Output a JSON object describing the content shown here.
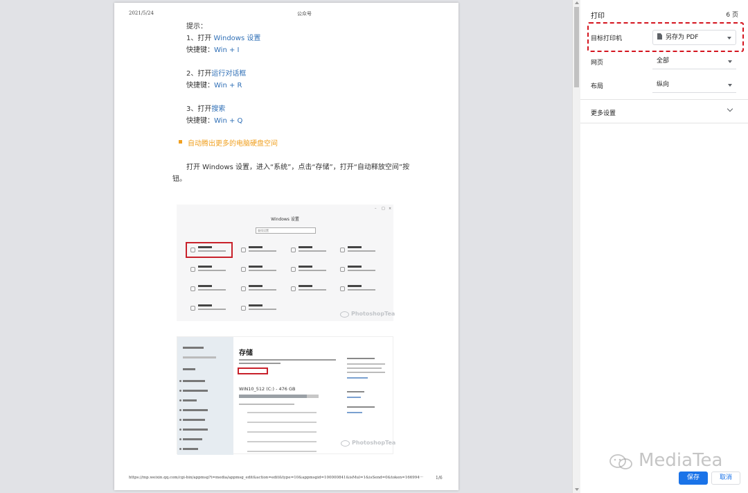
{
  "page": {
    "header_date": "2021/5/24",
    "header_title": "公众号",
    "footer_url": "https://mp.weixin.qq.com/cgi-bin/appmsg?t=media/appmsg_edit&action=edit&type=10&appmsgid=100000841&isMul=1&isSend=0&token=166994···",
    "footer_page": "1/6",
    "tip_label": "提示：",
    "item1_prefix": "1、打开 ",
    "item1_link": "Windows 设置",
    "item1_key_label": "快捷键：",
    "item1_key": "Win + I",
    "item2_prefix": "2、打开",
    "item2_link": "运行对话框",
    "item2_key_label": "快捷键：",
    "item2_key": "Win + R",
    "item3_prefix": "3、打开",
    "item3_link": "搜索",
    "item3_key_label": "快捷键：",
    "item3_key": "Win + Q",
    "section_heading": "自动腾出更多的电脑硬盘空间",
    "para_line1": "打开 Windows 设置，进入“系统”，点击“存储”，打开“自动释放空间”按",
    "para_line2": "钮。",
    "shot1_title": "Windows 设置",
    "shot1_search": "查找设置",
    "shot2_heading": "存储",
    "shot2_drive": "WIN10_512 (C:) - 476 GB",
    "watermark": "PhotoshopTea"
  },
  "panel": {
    "title": "打印",
    "page_count": "6 页",
    "destination_label": "目标打印机",
    "destination_value": "另存为 PDF",
    "pages_label": "网页",
    "pages_value": "全部",
    "layout_label": "布局",
    "layout_value": "纵向",
    "more_settings": "更多设置",
    "save_label": "保存",
    "cancel_label": "取消"
  },
  "watermark_brand": "MediaTea",
  "colors": {
    "accent": "#1a73e8",
    "highlight_red": "#d4141e",
    "link_blue": "#2f6fb6",
    "heading_orange": "#f0a020"
  },
  "icons": [
    "pdf-icon",
    "chevron-down-icon",
    "caret-down-icon",
    "wechat-icon"
  ]
}
